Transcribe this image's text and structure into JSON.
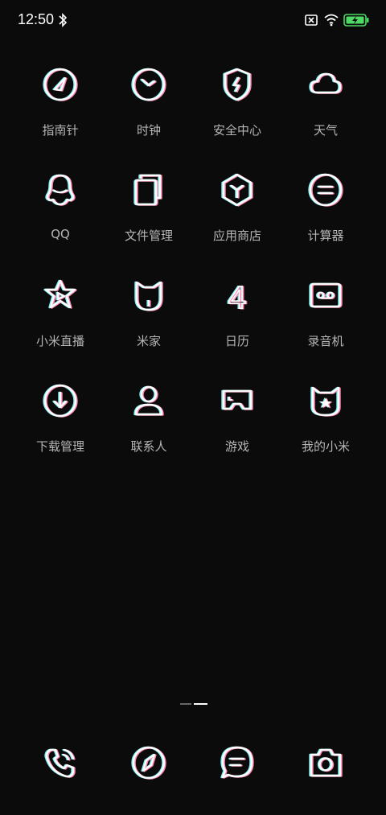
{
  "status_bar": {
    "time": "12:50",
    "icons": [
      "bluetooth-icon",
      "sim-none-icon",
      "wifi-icon",
      "battery-charging-icon"
    ],
    "battery_color": "#4cd964"
  },
  "apps": [
    {
      "label": "指南针",
      "icon": "compass-icon"
    },
    {
      "label": "时钟",
      "icon": "clock-icon"
    },
    {
      "label": "安全中心",
      "icon": "shield-bolt-icon"
    },
    {
      "label": "天气",
      "icon": "cloud-icon"
    },
    {
      "label": "QQ",
      "icon": "penguin-icon"
    },
    {
      "label": "文件管理",
      "icon": "files-icon"
    },
    {
      "label": "应用商店",
      "icon": "hexagon-store-icon"
    },
    {
      "label": "计算器",
      "icon": "equals-circle-icon"
    },
    {
      "label": "小米直播",
      "icon": "star-play-icon"
    },
    {
      "label": "米家",
      "icon": "mi-home-icon"
    },
    {
      "label": "日历",
      "icon": "calendar-number-icon"
    },
    {
      "label": "录音机",
      "icon": "tape-icon"
    },
    {
      "label": "下载管理",
      "icon": "download-circle-icon"
    },
    {
      "label": "联系人",
      "icon": "person-icon"
    },
    {
      "label": "游戏",
      "icon": "gamepad-icon"
    },
    {
      "label": "我的小米",
      "icon": "mi-bunny-icon"
    }
  ],
  "calendar_number": "4",
  "dock": [
    {
      "icon": "phone-icon"
    },
    {
      "icon": "browser-compass-icon"
    },
    {
      "icon": "message-icon"
    },
    {
      "icon": "camera-icon"
    }
  ],
  "theme": {
    "cyan": "#39e3ef",
    "pink": "#ff3d6e",
    "label_color": "#b5b5b5"
  }
}
